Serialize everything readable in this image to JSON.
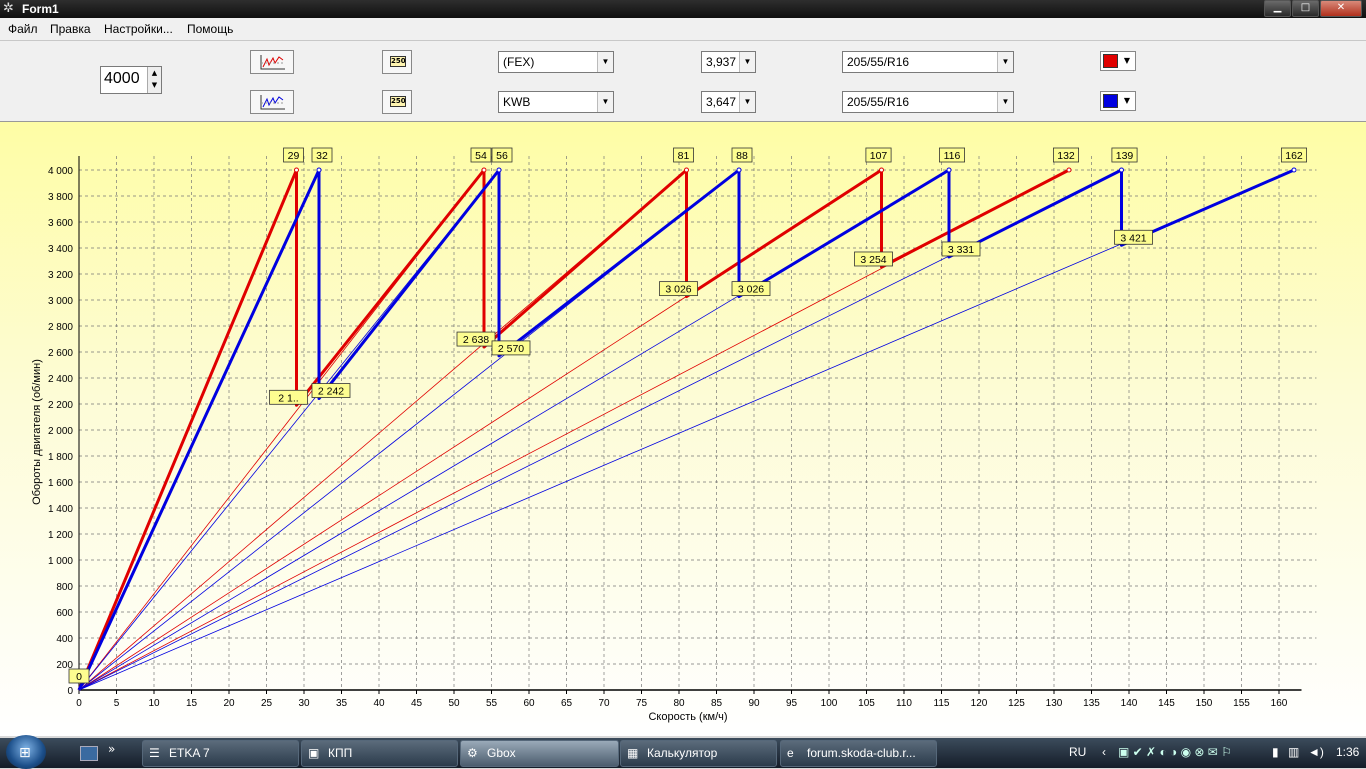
{
  "window": {
    "title": "Form1",
    "minimize": "▁",
    "maximize": "□",
    "close": "✕"
  },
  "menu": [
    "Файл",
    "Правка",
    "Настройки...",
    "Помощь"
  ],
  "toolbar": {
    "rpm_value": "4000",
    "row1": {
      "gearbox": "(FEX)",
      "final_drive": "3,937",
      "tyre": "205/55/R16",
      "color": "#e00000",
      "btn_label": "250"
    },
    "row2": {
      "gearbox": "KWB",
      "final_drive": "3,647",
      "tyre": "205/55/R16",
      "color": "#0000e0",
      "btn_label": "250"
    }
  },
  "chart_data": {
    "type": "line",
    "xlabel": "Скорость (км/ч)",
    "ylabel": "Обороты двигателя (об/мин)",
    "xlim": [
      0,
      165
    ],
    "ylim": [
      0,
      4000
    ],
    "x_ticks": [
      0,
      5,
      10,
      15,
      20,
      25,
      30,
      35,
      40,
      45,
      50,
      55,
      60,
      65,
      70,
      75,
      80,
      85,
      90,
      95,
      100,
      105,
      110,
      115,
      120,
      125,
      130,
      135,
      140,
      145,
      150,
      155,
      160
    ],
    "y_ticks": [
      0,
      200,
      400,
      600,
      800,
      1000,
      1200,
      1400,
      1600,
      1800,
      2000,
      2200,
      2400,
      2600,
      2800,
      3000,
      3200,
      3400,
      3600,
      3800,
      4000
    ],
    "y_tick_labels": [
      "0",
      "200",
      "400",
      "600",
      "800",
      "1 000",
      "1 200",
      "1 400",
      "1 600",
      "1 800",
      "2 000",
      "2 200",
      "2 400",
      "2 600",
      "2 800",
      "3 000",
      "3 200",
      "3 400",
      "3 600",
      "3 800",
      "4 000"
    ],
    "grid": true,
    "series": [
      {
        "color": "#e00000",
        "gear_top_speeds": [
          29,
          54,
          81,
          107,
          132
        ],
        "top_labels": [
          "29",
          "54",
          "81",
          "107",
          "132"
        ],
        "shift_rpms": [
          2190,
          2638,
          3026,
          3254
        ],
        "shift_labels": [
          "2 1..",
          "2 638",
          "3 026",
          "3 254"
        ]
      },
      {
        "color": "#0000e0",
        "gear_top_speeds": [
          32,
          56,
          88,
          116,
          139,
          162
        ],
        "top_labels": [
          "32",
          "56",
          "88",
          "116",
          "139",
          "162"
        ],
        "shift_rpms": [
          2242,
          2570,
          3026,
          3331,
          3421
        ],
        "shift_labels": [
          "2 242",
          "2 570",
          "3 026",
          "3 331",
          "3 421"
        ]
      }
    ],
    "origin_label": "0"
  },
  "taskbar": {
    "items": [
      {
        "label": "ETKA 7",
        "icon": "etka-icon",
        "glyph": "☰"
      },
      {
        "label": "КПП",
        "icon": "folder-icon",
        "glyph": "▣"
      },
      {
        "label": "Gbox",
        "icon": "gear-icon",
        "glyph": "⚙"
      },
      {
        "label": "Калькулятор",
        "icon": "calculator-icon",
        "glyph": "▦"
      },
      {
        "label": "forum.skoda-club.r...",
        "icon": "ie-icon",
        "glyph": "e"
      }
    ],
    "lang": "RU",
    "clock": "1:36"
  }
}
